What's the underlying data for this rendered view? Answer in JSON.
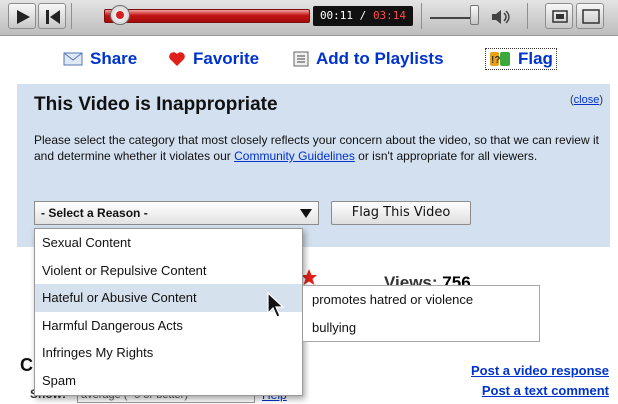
{
  "player": {
    "time_current": "00:11",
    "time_separator": " / ",
    "time_total": "03:14",
    "progress_fraction": 0.056,
    "icons": [
      "play-icon",
      "next-icon",
      "volume-icon",
      "fullscreen-icon"
    ]
  },
  "actions": {
    "share": "Share",
    "favorite": "Favorite",
    "add_to_playlists": "Add to Playlists",
    "flag": "Flag"
  },
  "panel": {
    "title": "This Video is Inappropriate",
    "close_open": "(",
    "close_label": "close",
    "close_close": ")",
    "desc_before": "Please select the category that most closely reflects your concern about the video, so that we can review it and determine whether it violates our ",
    "desc_link": "Community Guidelines",
    "desc_after": " or isn't appropriate for all viewers.",
    "select_value": "- Select a Reason -",
    "flag_button": "Flag This Video",
    "background_color": "#d3e0ef"
  },
  "reasons": {
    "items": [
      "Sexual Content",
      "Violent or Repulsive Content",
      "Hateful or Abusive Content",
      "Harmful Dangerous Acts",
      "Infringes My Rights",
      "Spam"
    ],
    "hovered_index": 2,
    "sub_items": [
      "promotes hatred or violence",
      "bullying"
    ]
  },
  "page": {
    "views_label": "Views:",
    "views_value": "756",
    "comments_heading_partial": "C",
    "show_label": "Show:",
    "show_value": "average (- 5 or better)",
    "help_link": "Help",
    "post_video_response": "Post a video response",
    "post_text_comment": "Post a text comment"
  },
  "colors": {
    "link": "#0033cc",
    "progress": "#c41414",
    "hover": "#d6e1ee"
  }
}
